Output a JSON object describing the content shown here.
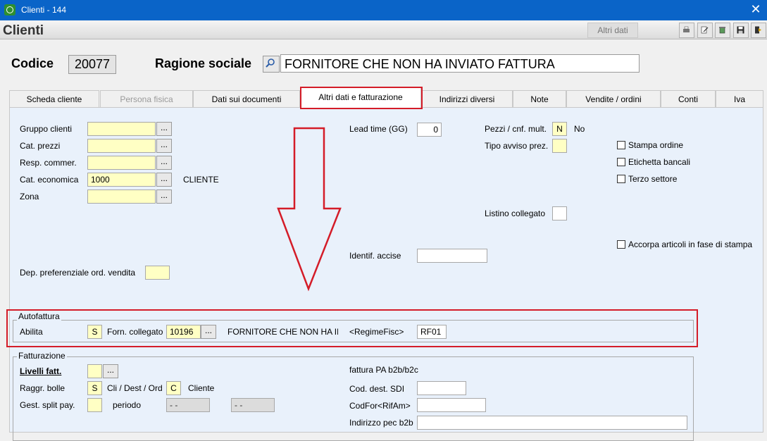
{
  "window": {
    "title": "Clienti - 144",
    "close_glyph": "✕"
  },
  "header": {
    "title": "Clienti",
    "altri_dati": "Altri dati"
  },
  "top": {
    "codice_label": "Codice",
    "codice_value": "20077",
    "ragione_label": "Ragione sociale",
    "ragione_value": "FORNITORE CHE NON HA INVIATO FATTURA"
  },
  "tabs": [
    {
      "label": "Scheda cliente"
    },
    {
      "label": "Persona fisica"
    },
    {
      "label": "Dati sui documenti"
    },
    {
      "label": "Altri dati e fatturazione"
    },
    {
      "label": "Indirizzi diversi"
    },
    {
      "label": "Note"
    },
    {
      "label": "Vendite / ordini"
    },
    {
      "label": "Conti"
    },
    {
      "label": "Iva"
    }
  ],
  "left": {
    "gruppo_clienti": "Gruppo clienti",
    "cat_prezzi": "Cat. prezzi",
    "resp_commer": "Resp. commer.",
    "cat_economica": "Cat. economica",
    "cat_economica_value": "1000",
    "cat_economica_desc": "CLIENTE",
    "zona": "Zona",
    "dep_pref": "Dep. preferenziale ord. vendita"
  },
  "middle": {
    "lead_time": "Lead time (GG)",
    "lead_time_value": "0",
    "identif_accise": "Identif. accise"
  },
  "right": {
    "pezzi_cnf": "Pezzi / cnf. mult.",
    "pezzi_cnf_value": "N",
    "pezzi_cnf_desc": "No",
    "tipo_avviso": "Tipo avviso prez.",
    "listino_collegato": "Listino collegato",
    "stampa_ordine": "Stampa ordine",
    "etichetta_bancali": "Etichetta bancali",
    "terzo_settore": "Terzo settore",
    "accorpa": "Accorpa articoli in fase di stampa"
  },
  "autofattura": {
    "title": "Autofattura",
    "abilita": "Abilita",
    "abilita_value": "S",
    "forn_collegato": "Forn. collegato",
    "forn_value": "10196",
    "forn_desc": "FORNITORE CHE NON HA IN",
    "regime_label": "<RegimeFisc>",
    "regime_value": "RF01"
  },
  "fatturazione": {
    "title": "Fatturazione",
    "livelli_fatt": "Livelli fatt.",
    "raggr_bolle": "Raggr. bolle",
    "raggr_bolle_value": "S",
    "cli_dest_ord": "Cli / Dest / Ord",
    "cli_dest_ord_value": "C",
    "cliente": "Cliente",
    "gest_split": "Gest. split pay.",
    "periodo": "periodo",
    "periodo_from": "- -",
    "periodo_to": "- -",
    "fattura_pa": "fattura PA b2b/b2c",
    "cod_dest_sdi": "Cod. dest. SDI",
    "codfor": "CodFor<RifAm>",
    "indirizzo_pec": "Indirizzo pec b2b"
  },
  "icons": {
    "app": "app-icon",
    "toolbar": [
      "print-icon",
      "edit-icon",
      "recycle-icon",
      "save-icon",
      "exit-icon"
    ],
    "search": "magnifier-icon"
  },
  "colors": {
    "titlebar": "#0a64c8",
    "input_yellow": "#ffffc4",
    "panel": "#e9f1fb",
    "annotation_red": "#d41c28"
  }
}
